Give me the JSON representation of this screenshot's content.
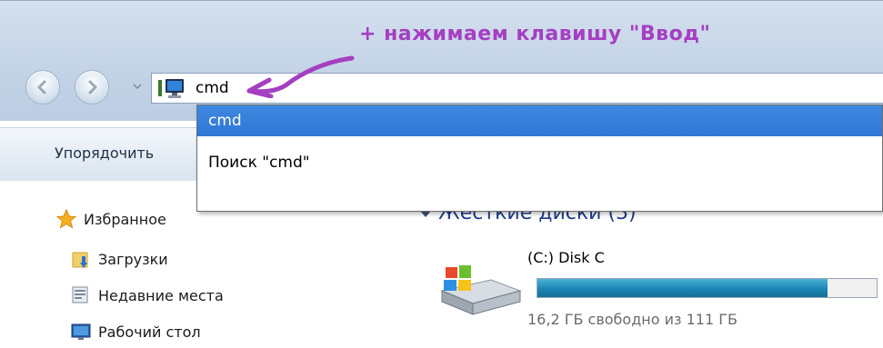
{
  "annotation": {
    "text": "+ нажимаем клавишу \"Ввод\"",
    "color": "#a53fc2"
  },
  "address_bar": {
    "value": "cmd",
    "icon": "computer-icon"
  },
  "autocomplete": {
    "items": [
      {
        "label": "cmd",
        "selected": true
      },
      {
        "label": "Поиск \"cmd\"",
        "selected": false
      }
    ],
    "highlight_color": "#3e88e0"
  },
  "toolbar": {
    "organize_label": "Упорядочить"
  },
  "nav_pane": {
    "favorites_label": "Избранное",
    "items": [
      {
        "label": "Загрузки",
        "icon": "downloads-folder-icon"
      },
      {
        "label": "Недавние места",
        "icon": "recent-places-icon"
      },
      {
        "label": "Рабочий стол",
        "icon": "desktop-icon"
      }
    ]
  },
  "content": {
    "section_header": "Жесткие диски (3)",
    "drive": {
      "name": "(C:) Disk C",
      "free_text": "16,2 ГБ свободно из 111 ГБ",
      "used_fraction": 0.854,
      "bar_color": "#1a86b5"
    }
  }
}
